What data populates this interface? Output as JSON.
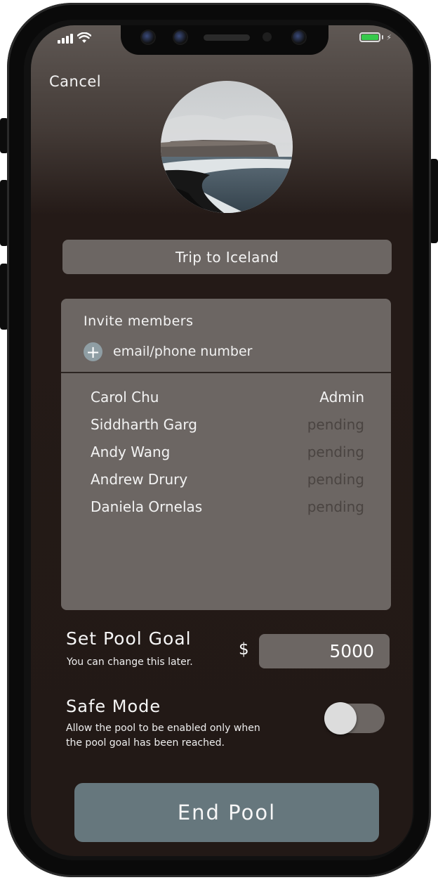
{
  "status_bar": {
    "signal_icon": "cellular-signal-icon",
    "wifi_icon": "wifi-icon",
    "battery_icon": "battery-charging-icon",
    "battery_color": "#36c94b"
  },
  "header": {
    "cancel_label": "Cancel"
  },
  "pool": {
    "photo_icon": "pool-cover-photo",
    "name": "Trip to Iceland"
  },
  "invite": {
    "title": "Invite members",
    "add_icon": "plus-circle-icon",
    "placeholder": "email/phone number"
  },
  "members": [
    {
      "name": "Carol Chu",
      "status": "Admin"
    },
    {
      "name": "Siddharth Garg",
      "status": "pending"
    },
    {
      "name": "Andy Wang",
      "status": "pending"
    },
    {
      "name": "Andrew Drury",
      "status": "pending"
    },
    {
      "name": "Daniela Ornelas",
      "status": "pending"
    }
  ],
  "goal": {
    "title": "Set Pool Goal",
    "subtitle": "You can change this later.",
    "currency": "$",
    "value": "5000"
  },
  "safe_mode": {
    "title": "Safe Mode",
    "description": "Allow the pool to be enabled only when the pool goal has been reached.",
    "enabled": false
  },
  "actions": {
    "end_pool_label": "End Pool",
    "end_pool_color": "#66777d"
  },
  "colors": {
    "card": "#6c6663",
    "background": "#221916",
    "pending_text": "#4a4441"
  }
}
